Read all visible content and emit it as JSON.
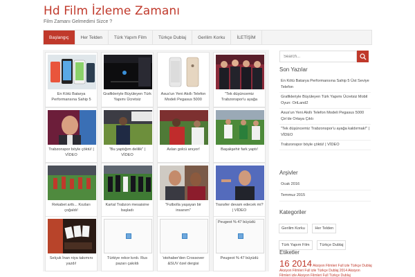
{
  "site": {
    "title": "Hd Film İzleme Zamanı",
    "tagline": "Film Zamanı Gelmedimi Sizce ?"
  },
  "nav": {
    "items": [
      {
        "label": "Başlangıç",
        "active": true
      },
      {
        "label": "Her Telden",
        "active": false
      },
      {
        "label": "Türk Yapım Film",
        "active": false
      },
      {
        "label": "Türkçe Dublaj",
        "active": false
      },
      {
        "label": "Gerilim Korku",
        "active": false
      },
      {
        "label": "İLETİŞİM",
        "active": false
      }
    ]
  },
  "posts": [
    {
      "caption": "En Kötü Batarya Performansına Sahip 5",
      "image": "phone-promo-image"
    },
    {
      "caption": "Grafikleriyle Büyüleyen Türk Yapımı Ücretsiz",
      "image": "dark-game-image"
    },
    {
      "caption": "Asus'un Yeni Akıllı Telefon Modeli Pegasus 5000",
      "image": "phones-image"
    },
    {
      "caption": "\"Tek düşüncemiz Trabzonspor'u ayağa",
      "image": "men-in-suits-image"
    },
    {
      "caption": "Trabzonspor böyle çöktü! | VİDEO",
      "image": "bald-man-image"
    },
    {
      "caption": "\"Bu yaptığım delilik\" | VİDEO",
      "image": "coach-image"
    },
    {
      "caption": "Aslan golcü anıyor!",
      "image": "footballer-image"
    },
    {
      "caption": "Başakşehir fark yaptı!",
      "image": "match-image"
    },
    {
      "caption": "Rekabet arttı... Kozları çoğaldı!",
      "image": "training-image"
    },
    {
      "caption": "Kartal Trabzon mesaisine başladı",
      "image": "team-training-image"
    },
    {
      "caption": "\"Futbolla yaşayan bir insanım\"",
      "image": "player-portrait-image"
    },
    {
      "caption": "Transfer devam edecek mi? | VİDEO",
      "image": "coach-portrait-image"
    },
    {
      "caption": "Selçuk İnan niya takımını yazdı!",
      "image": "cards-image"
    },
    {
      "caption": "Türkiye rekor kırdı. Rus pazarı çakıldı",
      "image": "broken-image"
    },
    {
      "caption": "'otohaber'den Crossover &SUV özel dergisi",
      "image": "broken-image"
    },
    {
      "caption": "Peugeot % 47 büyüdü",
      "image": "broken-image",
      "alt": "Peugeot % 47 büyüdü"
    }
  ],
  "search": {
    "placeholder": "Search...",
    "icon": "search-icon"
  },
  "recent_posts": {
    "title": "Son Yazılar",
    "items": [
      "En Kötü Batarya Performansına Sahip 5 Üst Seviye Telefon",
      "Grafikleriyle Büyüleyen Türk Yapımı Ücretsiz Mobil Oyun: OriLand2",
      "Asus'un Yeni Akıllı Telefon Modeli Pegasus 5000 Çin'de Ortaya Çıktı",
      "\"Tek düşüncemiz Trabzonspor'u ayağa kaldırmak!\" | VİDEO",
      "Trabzonspor böyle çöktü! | VİDEO"
    ]
  },
  "archives": {
    "title": "Arşivler",
    "items": [
      "Ocak 2016",
      "Temmuz 2015"
    ]
  },
  "categories": {
    "title": "Kategoriler",
    "items": [
      "Gerilim Korku",
      "Her Telden",
      "Türk Yapım Film",
      "Türkçe Dublaj"
    ]
  },
  "tags": {
    "title": "Etiketler",
    "big": "16 2014",
    "small": "Aksiyon Filmleri Full izle Türkçe Dublaj Aksiyon Filmleri Full izle Türkçe Dublaj 2014 Aksiyon Filmleri izle Aksiyon Filmleri Full Türkçe Dublaj"
  },
  "colors": {
    "accent": "#c0392b",
    "nav_bg": "#f4f4f4"
  }
}
